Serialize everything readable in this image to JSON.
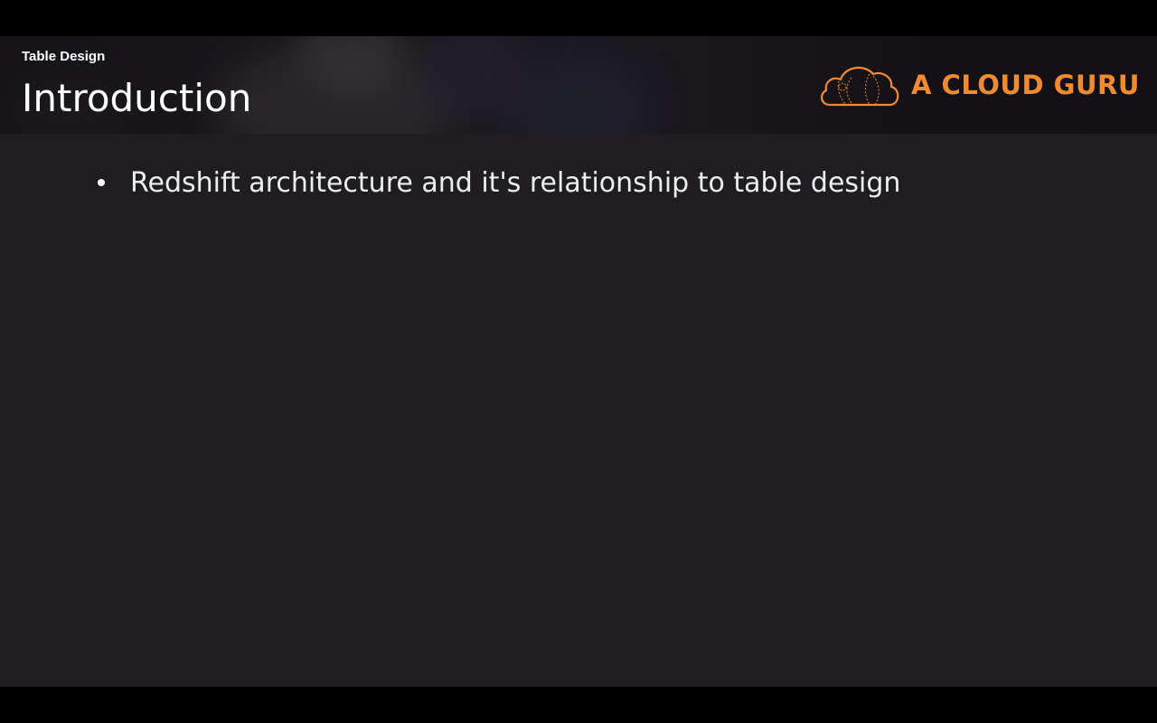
{
  "slide": {
    "section_label": "Table Design",
    "title": "Introduction",
    "bullets": [
      "Redshift architecture and it's relationship to table design"
    ]
  },
  "branding": {
    "logo_icon": "cloud-icon",
    "logo_text": "A CLOUD GURU",
    "accent_color": "#f28b30"
  },
  "colors": {
    "slide_background": "#1f1d21",
    "letterbox": "#000000",
    "text": "#ffffff"
  }
}
